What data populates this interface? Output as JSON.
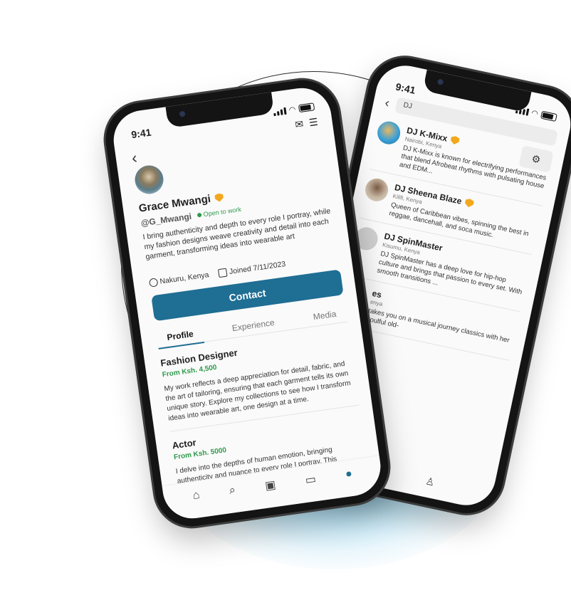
{
  "colors": {
    "accent": "#1f6e94",
    "success": "#2e9a4c",
    "verified": "#f2a81d",
    "glow": "#54bae4"
  },
  "front_phone": {
    "status_time": "9:41",
    "header_icons": [
      "mail-icon",
      "menu-icon"
    ],
    "profile": {
      "name": "Grace Mwangi",
      "handle": "@G_Mwangi",
      "status_badge": "Open to work",
      "bio": "I bring authenticity and depth to every role I portray, while my fashion designs weave creativity and detail into each garment, transforming ideas into wearable art",
      "location": "Nakuru, Kenya",
      "joined": "Joined 7/11/2023"
    },
    "contact_label": "Contact",
    "tabs": [
      "Profile",
      "Experience",
      "Media"
    ],
    "active_tab": "Profile",
    "sections": [
      {
        "title": "Fashion Designer",
        "price": "From Ksh. 4,500",
        "body": "My work reflects a deep appreciation for detail, fabric, and the art of tailoring, ensuring that each garment tells its own unique story. Explore my collections to see how I transform ideas into wearable art, one design at a time."
      },
      {
        "title": "Actor",
        "price": "From Ksh. 5000",
        "body": "I delve into the depths of human emotion, bringing authenticity and nuance to every role I portray. This"
      }
    ],
    "nav_icons": [
      "home-icon",
      "search-icon",
      "briefcase-icon",
      "wallet-icon",
      "profile-icon"
    ]
  },
  "back_phone": {
    "status_time": "9:41",
    "search_value": "DJ",
    "results": [
      {
        "name": "DJ K-Mixx",
        "location": "Nairobi, Kenya",
        "verified": true,
        "description": "DJ K-Mixx is known for electrifying performances that blend Afrobeat rhythms with pulsating house and EDM..."
      },
      {
        "name": "DJ Sheena Blaze",
        "location": "Kilifi, Kenya",
        "verified": true,
        "description": "Queen of Caribbean vibes, spinning the best in reggae, dancehall, and soca music."
      },
      {
        "name": "DJ SpinMaster",
        "location": "Kisumu, Kenya",
        "verified": false,
        "description": "DJ SpinMaster has a deep love for hip-hop culture and brings that passion to every set. With smooth transitions ..."
      },
      {
        "name": "es",
        "location": "enya",
        "verified": false,
        "description": "takes you on a musical journey classics with her soulful old-"
      }
    ],
    "nav_icons": [
      "wallet-icon",
      "profile-icon"
    ]
  }
}
